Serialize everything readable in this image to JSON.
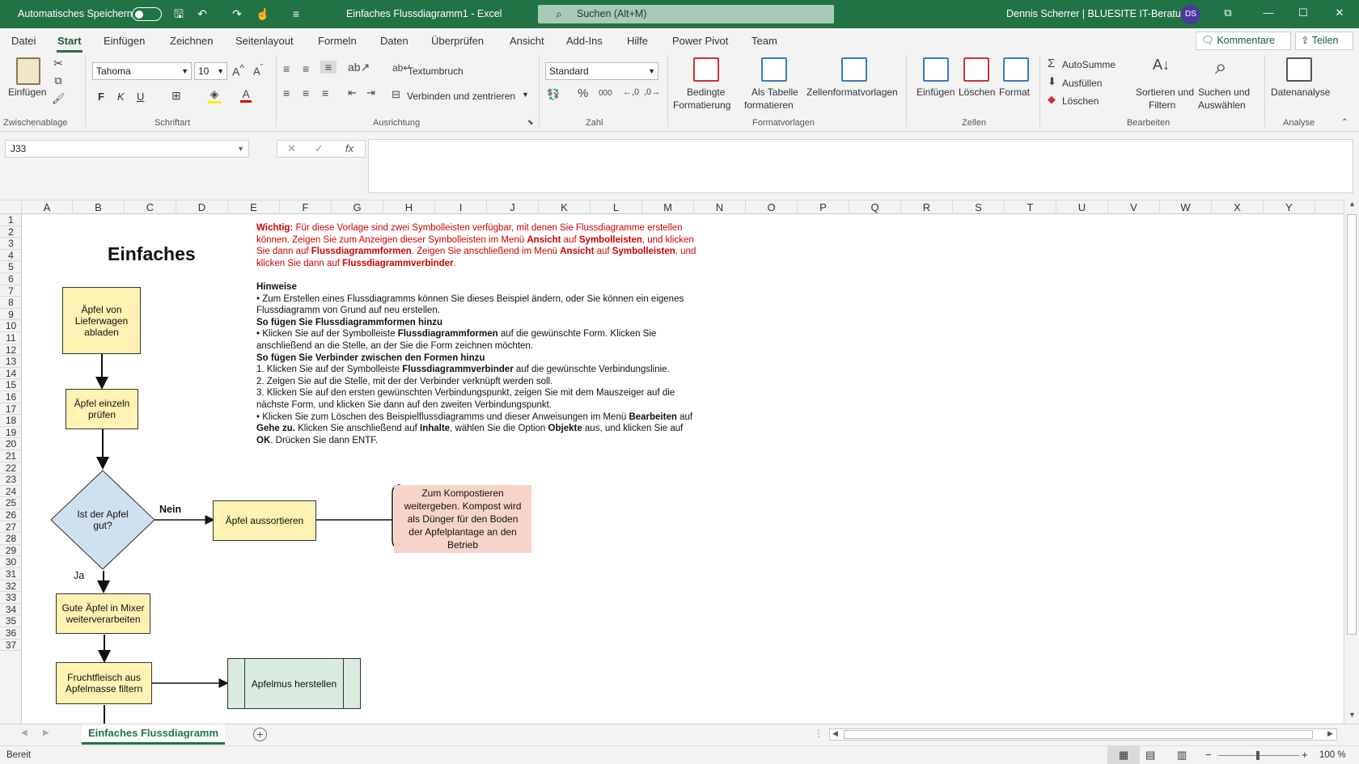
{
  "titlebar": {
    "autosave_label": "Automatisches Speichern",
    "doc_title": "Einfaches Flussdiagramm1  -  Excel",
    "search_placeholder": "Suchen (Alt+M)",
    "user": "Dennis Scherrer | BLUESITE IT-Beratung",
    "avatar_initials": "DS"
  },
  "menu": {
    "tabs": [
      "Datei",
      "Start",
      "Einfügen",
      "Zeichnen",
      "Seitenlayout",
      "Formeln",
      "Daten",
      "Überprüfen",
      "Ansicht",
      "Add-Ins",
      "Hilfe",
      "Power Pivot",
      "Team"
    ],
    "active_tab": "Start",
    "comments_label": "Kommentare",
    "share_label": "Teilen"
  },
  "ribbon": {
    "paste_label": "Einfügen",
    "clipboard_group": "Zwischenablage",
    "font_name": "Tahoma",
    "font_size": "10",
    "font_group": "Schriftart",
    "bold": "F",
    "italic": "K",
    "underline": "U",
    "wrap_label": "Textumbruch",
    "merge_label": "Verbinden und zentrieren",
    "alignment_group": "Ausrichtung",
    "number_format": "Standard",
    "number_group": "Zahl",
    "cond_format_l1": "Bedingte",
    "cond_format_l2": "Formatierung",
    "as_table_l1": "Als Tabelle",
    "as_table_l2": "formatieren",
    "cell_styles": "Zellenformatvorlagen",
    "styles_group": "Formatvorlagen",
    "insert_label": "Einfügen",
    "delete_label": "Löschen",
    "format_label": "Format",
    "cells_group": "Zellen",
    "autosum_label": "AutoSumme",
    "fill_label": "Ausfüllen",
    "clear_label": "Löschen",
    "sort_l1": "Sortieren und",
    "sort_l2": "Filtern",
    "find_l1": "Suchen und",
    "find_l2": "Auswählen",
    "editing_group": "Bearbeiten",
    "analyze_label": "Datenanalyse",
    "analysis_group": "Analyse"
  },
  "formula": {
    "name_box": "J33",
    "fx": "fx"
  },
  "columns": [
    "A",
    "B",
    "C",
    "D",
    "E",
    "F",
    "G",
    "H",
    "I",
    "J",
    "K",
    "L",
    "M",
    "N",
    "O",
    "P",
    "Q",
    "R",
    "S",
    "T",
    "U",
    "V",
    "W",
    "X",
    "Y"
  ],
  "rows": [
    "1",
    "2",
    "3",
    "4",
    "5",
    "6",
    "7",
    "8",
    "9",
    "10",
    "11",
    "12",
    "13",
    "14",
    "15",
    "16",
    "17",
    "18",
    "19",
    "20",
    "21",
    "22",
    "23",
    "24",
    "25",
    "26",
    "27",
    "28",
    "29",
    "30",
    "31",
    "32",
    "33",
    "34",
    "35",
    "36",
    "37"
  ],
  "sheet": {
    "title": "Einfaches",
    "notes": {
      "important_label": "Wichtig:",
      "important_p1": " Für diese Vorlage sind zwei Symbolleisten verfügbar, mit denen Sie Flussdiagramme erstellen können. Zeigen Sie zum Anzeigen dieser Symbolleisten im Menü ",
      "b_ansicht": "Ansicht",
      "t_auf": " auf ",
      "b_symbolleisten": "Symbolleisten",
      "important_p2": ", und klicken Sie dann auf ",
      "b_formen": "Flussdiagrammformen",
      "important_p3": ". Zeigen Sie anschließend im Menü ",
      "b_ansicht2": "Ansicht",
      "t_auf2": " auf ",
      "b_symbolleisten2": "Symbolleisten",
      "important_p4": ", und klicken Sie dann auf ",
      "b_verbinder": "Flussdiagrammverbinder",
      "important_end": ".",
      "hints_title": "Hinweise",
      "hint1": "• Zum Erstellen eines Flussdiagramms können Sie dieses Beispiel ändern, oder Sie können ein eigenes Flussdiagramm von Grund auf neu erstellen.",
      "shapes_title": "So fügen Sie Flussdiagrammformen hinzu",
      "shapes_a": "• Klicken Sie auf der Symbolleiste ",
      "shapes_b": "Flussdiagrammformen",
      "shapes_c": " auf die gewünschte Form. Klicken Sie anschließend an die Stelle, an der Sie die Form zeichnen möchten.",
      "conn_title": "So fügen Sie Verbinder zwischen den Formen hinzu",
      "conn1_a": "1. Klicken Sie auf der Symbolleiste ",
      "conn1_b": "Flussdiagrammverbinder",
      "conn1_c": " auf die gewünschte Verbindungslinie.",
      "conn2": "2. Zeigen Sie auf die Stelle, mit der der Verbinder verknüpft werden soll.",
      "conn3": "3. Klicken Sie auf den ersten gewünschten Verbindungspunkt, zeigen Sie mit dem Mauszeiger auf die nächste Form, und klicken Sie dann auf den zweiten Verbindungspunkt.",
      "del_a": "• Klicken Sie zum Löschen des Beispielflussdiagramms und dieser Anweisungen im Menü ",
      "del_b": "Bearbeiten",
      "del_c": " auf ",
      "del_d": "Gehe zu.",
      "del_e": " Klicken Sie anschließend auf ",
      "del_f": "Inhalte",
      "del_g": ", wählen Sie die Option ",
      "del_h": "Objekte",
      "del_i": " aus, und klicken Sie auf ",
      "del_j": "OK",
      "del_k": ". Drücken Sie dann ENTF."
    },
    "flow": {
      "step1": "Äpfel von Lieferwagen abladen",
      "step2": "Äpfel einzeln prüfen",
      "decision": "Ist der Apfel gut?",
      "no_label": "Nein",
      "yes_label": "Ja",
      "sort_out": "Äpfel aussortieren",
      "compost": "Zum Kompostieren weitergeben. Kompost wird als Dünger für den Boden der Apfelplantage an den Betrieb",
      "mixer": "Gute Äpfel in Mixer weiterverarbeiten",
      "filter": "Fruchtfleisch aus Apfelmasse filtern",
      "applesauce": "Apfelmus herstellen"
    }
  },
  "sheettabs": {
    "active": "Einfaches Flussdiagramm"
  },
  "status": {
    "ready": "Bereit",
    "zoom": "100 %"
  }
}
